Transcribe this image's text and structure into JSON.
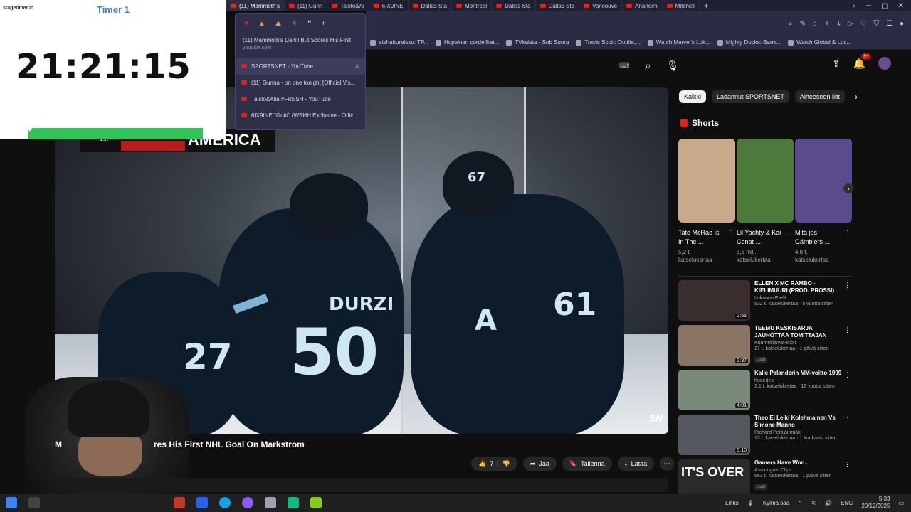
{
  "timer": {
    "logo": "stagetimer.io",
    "title": "Timer 1",
    "value": "21:21:15",
    "progress": 0.88
  },
  "tabs": [
    {
      "label": "(11) Mammoth's",
      "active": true
    },
    {
      "label": "(11) Gunn",
      "active": false
    },
    {
      "label": "Taisto&Al",
      "active": false
    },
    {
      "label": "6IX9INE",
      "active": false
    },
    {
      "label": "Dallas Sta",
      "active": false
    },
    {
      "label": "Montreal",
      "active": false
    },
    {
      "label": "Dallas Sta",
      "active": false
    },
    {
      "label": "Dallas Sta",
      "active": false
    },
    {
      "label": "Vancouve",
      "active": false
    },
    {
      "label": "Anaheim",
      "active": false
    },
    {
      "label": "Mitchell",
      "active": false
    }
  ],
  "popup": {
    "first_title": "(11) Mammoth's Daniil But Scores His First",
    "first_url": "youtube.com",
    "items": [
      {
        "label": "SPORTSNET - YouTube",
        "highlight": true
      },
      {
        "label": "(11) Gunna - on one tonight [Official Vis...",
        "highlight": false
      },
      {
        "label": "Taisto&Alla #FRESH - YouTube",
        "highlight": false
      },
      {
        "label": "6IX9INE \"Gotti\" (WSHH Exclusive - Offic...",
        "highlight": false
      }
    ]
  },
  "bookmarks": [
    "atshattureissu: TP...",
    "Hopeinen cordellket...",
    "TVkaista - Sub Suora",
    "Travis Scott: Outfits,...",
    "Watch Marvel's Luk...",
    "Mighty Ducks: Bank...",
    "Watch Global & Loc..."
  ],
  "notifications": "9+",
  "scoreboard": {
    "period": "1st",
    "text": "AMERICA"
  },
  "video": {
    "title_prefix": "M",
    "title": "res His First NHL Goal On Markstrom",
    "watermark": "SN"
  },
  "actions": {
    "likes": "7",
    "share": "Jaa",
    "save": "Tallenna",
    "download": "Lataa"
  },
  "chips": [
    "Kaikki",
    "Ladannut SPORTSNET",
    "Aiheeseen liitt"
  ],
  "shorts_header": "Shorts",
  "shorts": [
    {
      "title": "Tate McRae Is In The ...",
      "views": "5,2 t. katselukertaa",
      "color": "#c8a98a"
    },
    {
      "title": "Lil Yachty & Kai Cenat ...",
      "views": "3,6 milj. katselukertaa",
      "color": "#4d7a3a"
    },
    {
      "title": "Mitä jos Gämblers ...",
      "views": "4,8 t. katselukertaa",
      "color": "#5b4a8c"
    }
  ],
  "videos": [
    {
      "title": "ELLEN X MC RAMBO - KIELIMUURI (PROD. PROSSI)",
      "channel": "Lukanen Etelä",
      "stats": "532 t. katselukertaa · 5 vuotta sitten",
      "duration": "2:55",
      "new": "",
      "color": "#3a2d2d"
    },
    {
      "title": "TEEMU KESKISARJA JAUHOTTAA TOMITTAJAN",
      "channel": "Kuumetiljuvat-klipit",
      "stats": "27 t. katselukertaa · 1 päivä sitten",
      "duration": "2:37",
      "new": "Uusi",
      "color": "#8a7565"
    },
    {
      "title": "Kalle Palanderin MM-voitto 1999",
      "channel": "hooedes",
      "stats": "2,1 t. katselukertaa · 12 vuotta sitten",
      "duration": "4:01",
      "new": "",
      "color": "#7a8a7a"
    },
    {
      "title": "Theo Ei Leiki Kolehmainen Vs Simone Manno",
      "channel": "Richard Petäjäinmäki",
      "stats": "13 t. katselukertaa · 1 kuukausi sitten",
      "duration": "5:10",
      "new": "",
      "color": "#55585e"
    },
    {
      "title": "Gamers Have Won...",
      "channel": "Asmongold Clips",
      "stats": "663 t. katselukertaa · 1 päivä sitten",
      "duration": "",
      "new": "Uusi",
      "color": "#2a2a2a"
    }
  ],
  "taskbar": {
    "links": "Links",
    "weather": "Kylmä sää",
    "lang": "ENG",
    "time": "5.33",
    "date": "20/12/2025"
  }
}
